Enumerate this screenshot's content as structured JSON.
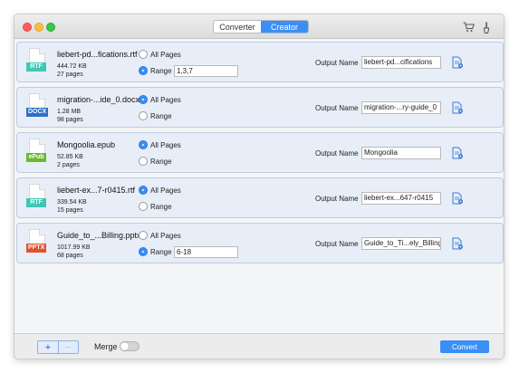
{
  "toolbar": {
    "tabs": [
      {
        "label": "Converter",
        "active": false
      },
      {
        "label": "Creator",
        "active": true
      }
    ],
    "icons": [
      "cart-icon",
      "brush-icon"
    ]
  },
  "files": [
    {
      "name": "liebert-pd...fications.rtf",
      "size": "444.72 KB",
      "pages": "27 pages",
      "type": "RTF",
      "type_color": "#3fc7b5",
      "option_all": "All Pages",
      "option_range": "Range",
      "selected": "range",
      "range_value": "1,3,7",
      "output_label": "Output Name",
      "output_value": "liebert-pd...cifications"
    },
    {
      "name": "migration-...ide_0.docx",
      "size": "1.28 MB",
      "pages": "98 pages",
      "type": "DOCX",
      "type_color": "#2f6fc6",
      "option_all": "All Pages",
      "option_range": "Range",
      "selected": "all",
      "range_value": "",
      "output_label": "Output Name",
      "output_value": "migration-...ry-guide_0"
    },
    {
      "name": "Mongoolia.epub",
      "size": "52.85 KB",
      "pages": "2 pages",
      "type": "ePub",
      "type_color": "#6ab931",
      "option_all": "All Pages",
      "option_range": "Range",
      "selected": "all",
      "range_value": "",
      "output_label": "Output Name",
      "output_value": "Mongoolia"
    },
    {
      "name": "liebert-ex...7-r0415.rtf",
      "size": "339.54 KB",
      "pages": "15 pages",
      "type": "RTF",
      "type_color": "#3fc7b5",
      "option_all": "All Pages",
      "option_range": "Range",
      "selected": "all",
      "range_value": "",
      "output_label": "Output Name",
      "output_value": "liebert-ex...647-r0415"
    },
    {
      "name": "Guide_to_...Billing.pptx",
      "size": "1017.99 KB",
      "pages": "68 pages",
      "type": "PPTX",
      "type_color": "#e0522c",
      "option_all": "All Pages",
      "option_range": "Range",
      "selected": "range",
      "range_value": "6-18",
      "output_label": "Output Name",
      "output_value": "Guide_to_Ti...ely_Billing"
    }
  ],
  "bottom": {
    "add_label": "+",
    "remove_label": "−",
    "merge_label": "Merge",
    "merge_on": false,
    "convert_label": "Convert"
  },
  "colors": {
    "accent": "#3a8ff7",
    "row_bg": "#e8eef8"
  }
}
